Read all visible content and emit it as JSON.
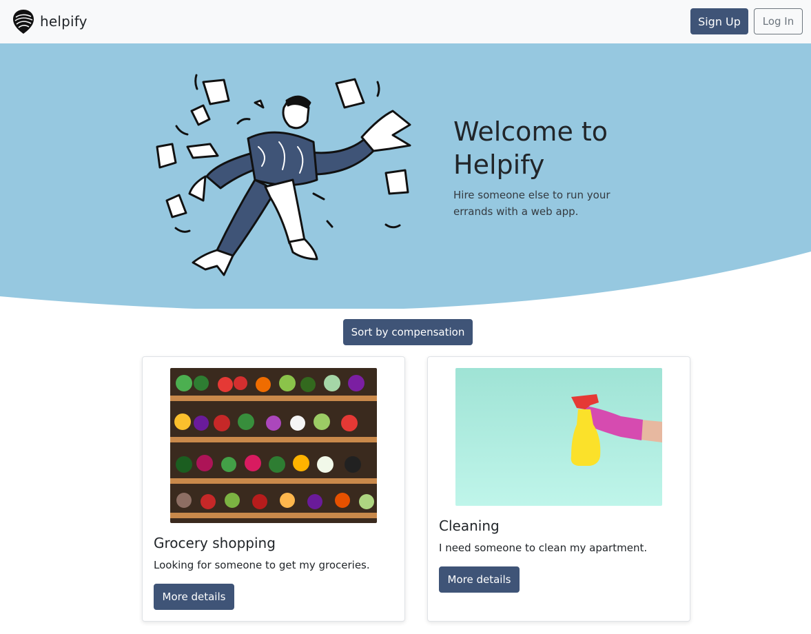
{
  "navbar": {
    "brand": "helpify",
    "signup_label": "Sign Up",
    "login_label": "Log In"
  },
  "hero": {
    "title": "Welcome to Helpify",
    "subtitle": "Hire someone else to run your errands with a web app.",
    "illustration_icon": "juggling-man-illustration",
    "background_color": "#96c8e0"
  },
  "sort_button_label": "Sort by compensation",
  "cards": [
    {
      "title": "Grocery shopping",
      "description": "Looking for someone to get my groceries.",
      "button_label": "More details",
      "image_icon": "grocery-shelves-photo"
    },
    {
      "title": "Cleaning",
      "description": "I need someone to clean my apartment.",
      "button_label": "More details",
      "image_icon": "spray-bottle-photo"
    }
  ],
  "colors": {
    "primary": "#3f5477",
    "navbar_bg": "#f8f9fa",
    "secondary": "#6c757d"
  }
}
